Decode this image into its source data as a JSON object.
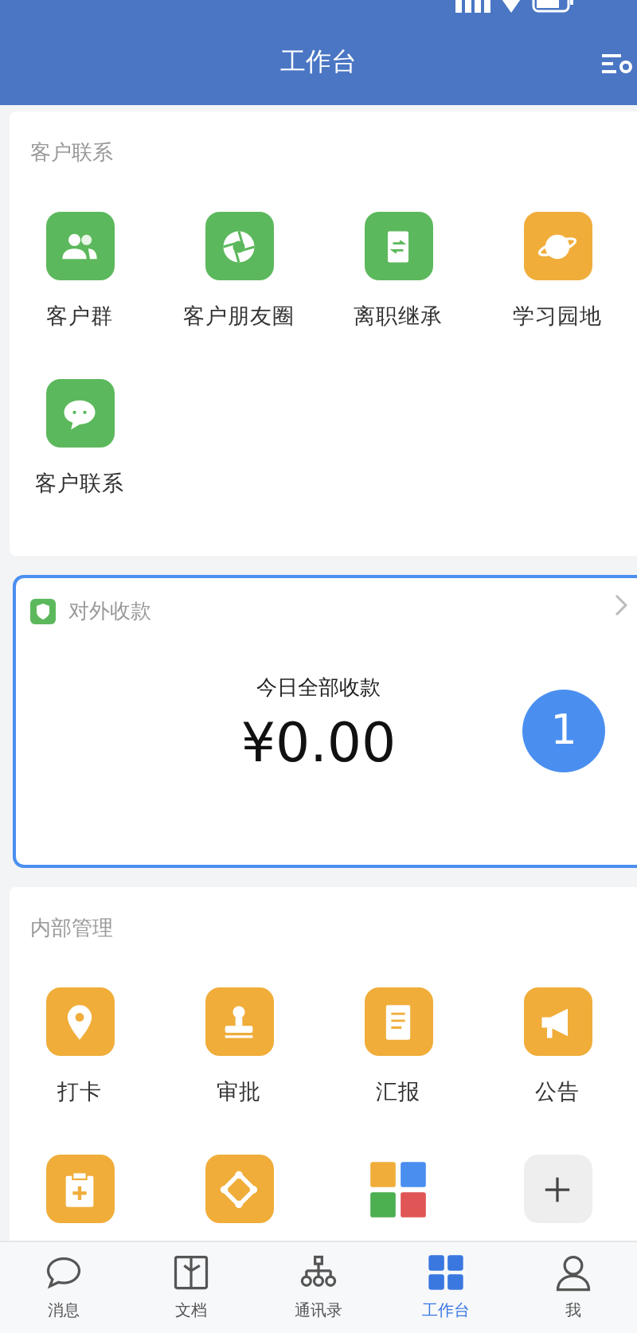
{
  "header": {
    "title": "工作台"
  },
  "sections": [
    {
      "title": "客户联系",
      "apps": [
        {
          "kind": "group",
          "label": "客户群",
          "color": "#5cb85c"
        },
        {
          "kind": "shutter",
          "label": "客户朋友圈",
          "color": "#5cb85c"
        },
        {
          "kind": "transfer",
          "label": "离职继承",
          "color": "#5cb85c"
        },
        {
          "kind": "planet",
          "label": "学习园地",
          "color": "#f0ad3a"
        },
        {
          "kind": "chat",
          "label": "客户联系",
          "color": "#5cb85c"
        }
      ]
    },
    {
      "kind": "payment",
      "title": "对外收款",
      "caption": "今日全部收款",
      "amount": "¥0.00",
      "badge": "1"
    },
    {
      "title": "内部管理",
      "apps": [
        {
          "kind": "pin",
          "label": "打卡",
          "color": "#f0ad3a"
        },
        {
          "kind": "stamp",
          "label": "审批",
          "color": "#f0ad3a"
        },
        {
          "kind": "report",
          "label": "汇报",
          "color": "#f0ad3a"
        },
        {
          "kind": "megaphone",
          "label": "公告",
          "color": "#f0ad3a"
        },
        {
          "kind": "clipboard",
          "color": "#f0ad3a"
        },
        {
          "kind": "network",
          "color": "#f0ad3a"
        },
        {
          "kind": "tiles"
        },
        {
          "kind": "add",
          "color": "#eeeeee"
        }
      ]
    }
  ],
  "tabbar": [
    {
      "kind": "chat",
      "label": "消息",
      "selected": false
    },
    {
      "kind": "doc",
      "label": "文档",
      "selected": false
    },
    {
      "kind": "org",
      "label": "通讯录",
      "selected": false
    },
    {
      "kind": "grid",
      "label": "工作台",
      "selected": true
    },
    {
      "kind": "person",
      "label": "我",
      "selected": false
    }
  ]
}
